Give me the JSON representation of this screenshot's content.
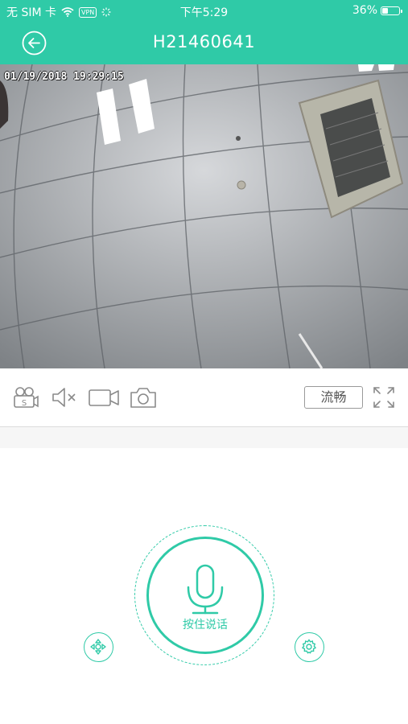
{
  "status_bar": {
    "carrier": "无 SIM 卡",
    "vpn": "VPN",
    "time": "下午5:29",
    "battery": "36%",
    "battery_level": 0.36
  },
  "nav": {
    "title": "H21460641",
    "back_icon": "back-arrow-circle-icon"
  },
  "video": {
    "timestamp": "01/19/2018 19:29:15"
  },
  "toolbar": {
    "icons": [
      "camera-switch-icon",
      "mute-icon",
      "record-video-icon",
      "snapshot-icon",
      "fullscreen-icon"
    ],
    "quality_label": "流畅"
  },
  "talk": {
    "label": "按住说话",
    "left_icon": "ptz-direction-icon",
    "right_icon": "settings-gear-icon"
  },
  "colors": {
    "accent": "#2fcaa7",
    "toolbar_icon": "#8a8a8a"
  }
}
